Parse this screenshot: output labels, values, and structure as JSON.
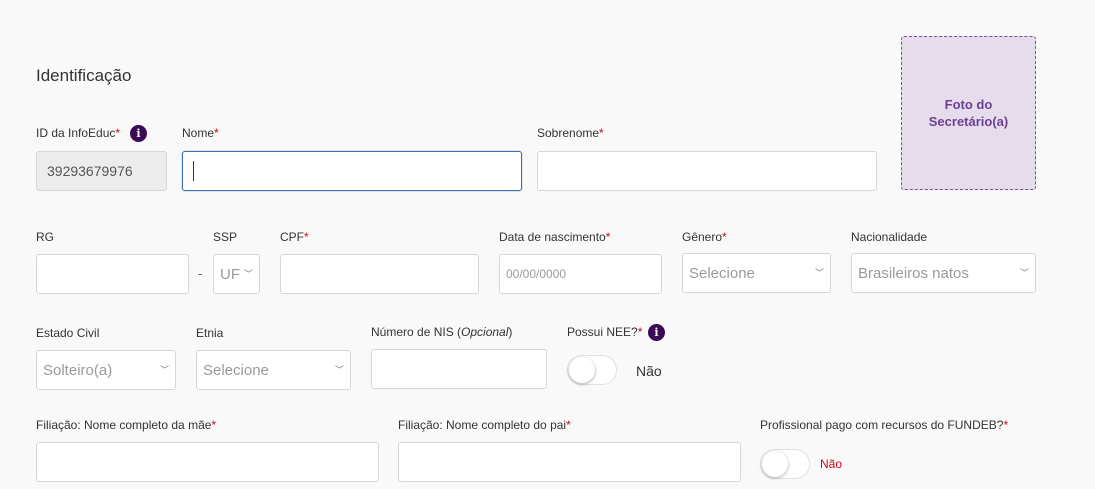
{
  "section": {
    "title": "Identificação"
  },
  "photo": {
    "label": "Foto do Secretário(a)"
  },
  "fields": {
    "infoeduc_id": {
      "label": "ID da InfoEduc",
      "value": "39293679976"
    },
    "nome": {
      "label": "Nome",
      "value": ""
    },
    "sobrenome": {
      "label": "Sobrenome",
      "value": ""
    },
    "rg": {
      "label": "RG",
      "value": ""
    },
    "ssp": {
      "label": "SSP",
      "selected": "UF"
    },
    "cpf": {
      "label": "CPF",
      "value": ""
    },
    "data_nascimento": {
      "label": "Data de nascimento",
      "placeholder": "00/00/0000"
    },
    "genero": {
      "label": "Gênero",
      "selected": "Selecione"
    },
    "nacionalidade": {
      "label": "Nacionalidade",
      "selected": "Brasileiros natos"
    },
    "estado_civil": {
      "label": "Estado Civil",
      "selected": "Solteiro(a)"
    },
    "etnia": {
      "label": "Etnia",
      "selected": "Selecione"
    },
    "nis": {
      "label": "Número de NIS (",
      "label_optional": "Opcional",
      "label_close": ")",
      "value": ""
    },
    "nee": {
      "label": "Possui NEE?",
      "state": "Não"
    },
    "filiacao_mae": {
      "label": "Filiação: Nome completo da mãe",
      "value": ""
    },
    "filiacao_pai": {
      "label": "Filiação: Nome completo do pai",
      "value": ""
    },
    "fundeb": {
      "label": "Profissional pago com recursos do FUNDEB?",
      "state": "Não"
    }
  },
  "symbols": {
    "required": "*",
    "separator": "-",
    "info": "i",
    "chevron": "﹀"
  },
  "colors": {
    "accent": "#3b0a57",
    "required": "#d0021b",
    "focus": "#3a6fb0",
    "photo_bg": "#e5dcec"
  }
}
